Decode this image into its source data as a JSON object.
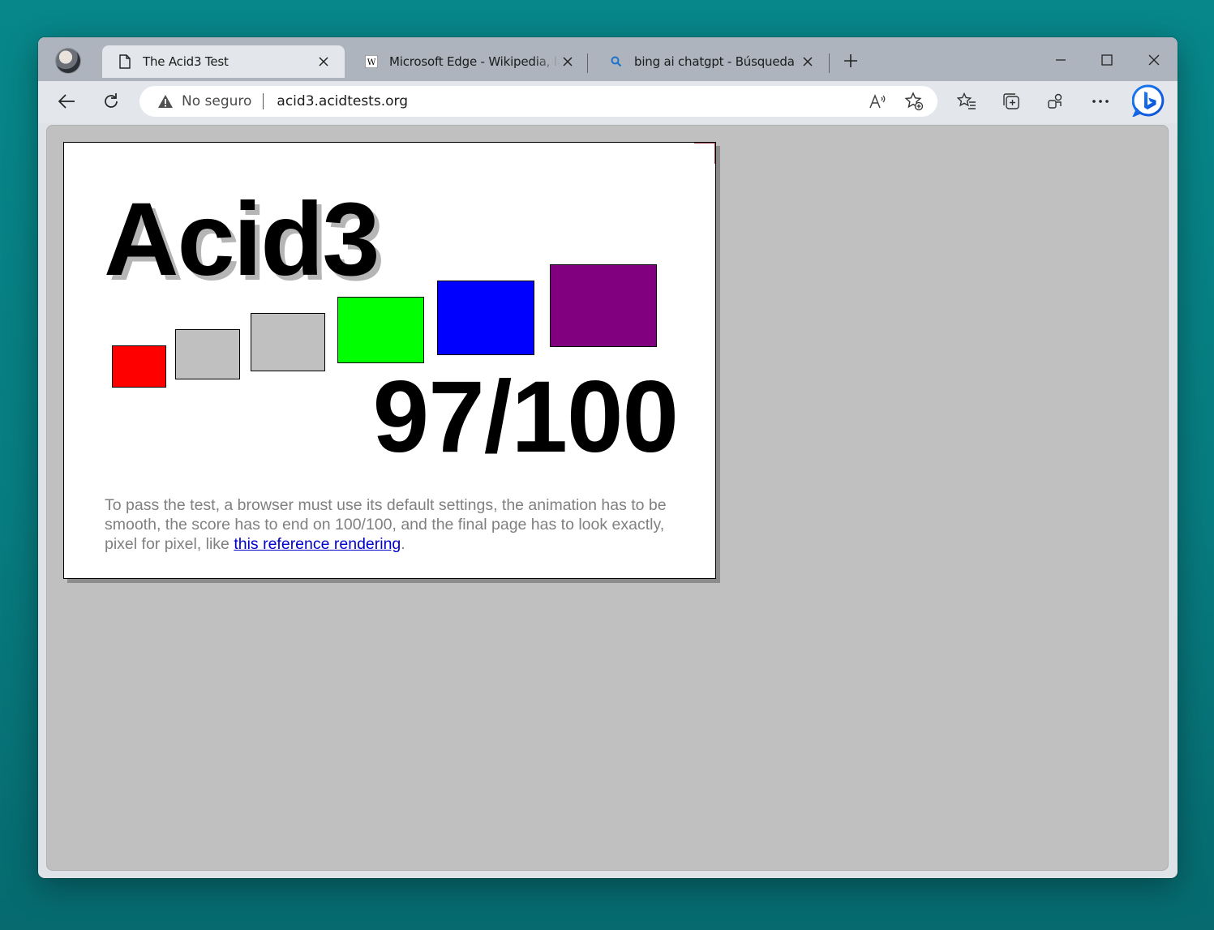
{
  "tabs": [
    {
      "title": "The Acid3 Test",
      "active": true,
      "favicon": "page-icon"
    },
    {
      "title": "Microsoft Edge - Wikipedia, la enciclopedia libre",
      "active": false,
      "favicon": "wikipedia-icon"
    },
    {
      "title": "bing ai chatgpt - Búsqueda",
      "active": false,
      "favicon": "search-icon"
    }
  ],
  "toolbar": {
    "security_label": "No seguro",
    "url": "acid3.acidtests.org"
  },
  "acid3": {
    "title": "Acid3",
    "score": "97/100",
    "boxes": [
      {
        "name": "red",
        "color": "#ff0000"
      },
      {
        "name": "gray-1",
        "color": "#c0c0c0"
      },
      {
        "name": "gray-2",
        "color": "#c0c0c0"
      },
      {
        "name": "green",
        "color": "#00ff00"
      },
      {
        "name": "blue",
        "color": "#0000ff"
      },
      {
        "name": "purple",
        "color": "#800080"
      }
    ],
    "instructions_before": "To pass the test, a browser must use its default settings, the animation has to be smooth, the score has to end on 100/100, and the final page has to look exactly, pixel for pixel, like ",
    "link_text": "this reference rendering",
    "instructions_after": "."
  },
  "colors": {
    "desktop": "#07878a",
    "viewport_bg": "#c0c0c0",
    "link": "#0000cc"
  }
}
